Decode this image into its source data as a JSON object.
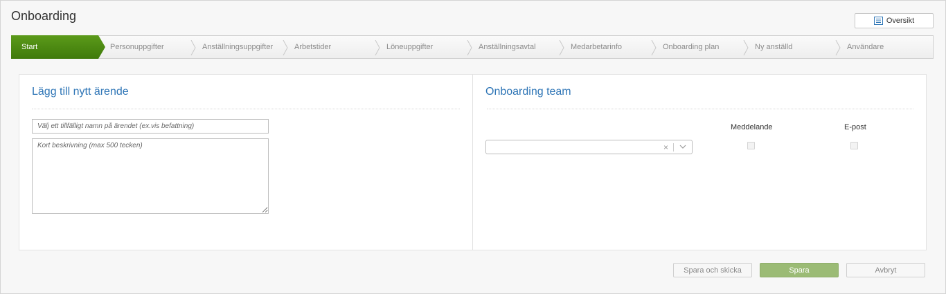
{
  "page": {
    "title": "Onboarding"
  },
  "header": {
    "overview_label": "Oversikt"
  },
  "wizard": {
    "steps": [
      {
        "label": "Start",
        "active": true
      },
      {
        "label": "Personuppgifter",
        "active": false
      },
      {
        "label": "Anställningsuppgifter",
        "active": false
      },
      {
        "label": "Arbetstider",
        "active": false
      },
      {
        "label": "Löneuppgifter",
        "active": false
      },
      {
        "label": "Anställningsavtal",
        "active": false
      },
      {
        "label": "Medarbetarinfo",
        "active": false
      },
      {
        "label": "Onboarding plan",
        "active": false
      },
      {
        "label": "Ny anställd",
        "active": false
      },
      {
        "label": "Användare",
        "active": false
      }
    ]
  },
  "new_case": {
    "title": "Lägg till nytt ärende",
    "name_placeholder": "Välj ett tillfälligt namn på ärendet (ex.vis befattning)",
    "name_value": "",
    "description_placeholder": "Kort beskrivning (max 500 tecken)",
    "description_value": ""
  },
  "team": {
    "title": "Onboarding team",
    "col_message": "Meddelande",
    "col_email": "E-post",
    "select_value": "",
    "clear_glyph": "×"
  },
  "footer": {
    "send_label": "Spara och skicka",
    "save_label": "Spara",
    "cancel_label": "Avbryt"
  },
  "colors": {
    "accent_green": "#4e8a0e",
    "title_blue": "#2e75b6",
    "save_green": "#9bbb75"
  },
  "icons": {
    "overview": "list-icon",
    "select_chevron": "chevron-down-icon",
    "select_clear": "close-icon"
  }
}
